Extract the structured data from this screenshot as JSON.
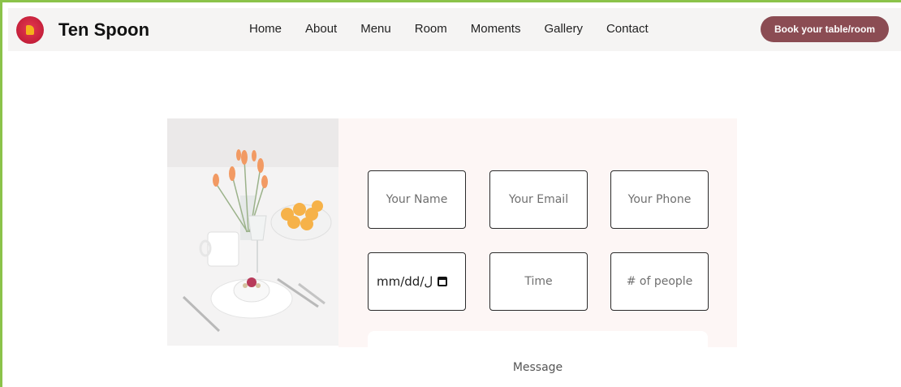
{
  "header": {
    "logo_text": "TEN SPOON",
    "brand": "Ten Spoon",
    "nav": [
      "Home",
      "About",
      "Menu",
      "Room",
      "Moments",
      "Gallery",
      "Contact"
    ],
    "cta_label": "Book your table/room"
  },
  "form": {
    "name_placeholder": "Your Name",
    "email_placeholder": "Your Email",
    "phone_placeholder": "Your Phone",
    "date_value": "mm/dd/ل",
    "time_placeholder": "Time",
    "people_placeholder": "# of people",
    "message_placeholder": "Message"
  },
  "colors": {
    "accent": "#8b4c53",
    "panel_bg": "#fdf6f5",
    "frame": "#8bc34a"
  }
}
